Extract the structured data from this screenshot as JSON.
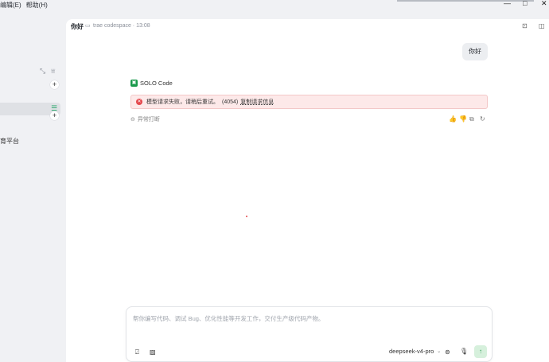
{
  "menubar": {
    "items": [
      "编辑(E)",
      "帮助(H)"
    ]
  },
  "window_controls": {
    "minimize": "—",
    "maximize": "□",
    "close": "✕"
  },
  "sidebar": {
    "collapse_icon": "⤡",
    "filter_icon": "⩸",
    "add_icon": "+",
    "list_icon": "☰",
    "partial_item_label": "育平台"
  },
  "header": {
    "title": "你好",
    "folder_icon": "▭",
    "path": "trae codespace · 13:08",
    "terminal_icon": "⊡",
    "panel_icon": "◫"
  },
  "conversation": {
    "user_message": "你好",
    "agent": {
      "badge": "▣",
      "name": "SOLO Code"
    },
    "error": {
      "icon": "✕",
      "message": "模型请求失败，请稍后重试。",
      "code": "(4054)",
      "link": "复制请求信息"
    },
    "stop": {
      "icon": "⊖",
      "label": "异常打断"
    },
    "actions": {
      "like": "👍",
      "dislike": "👎",
      "copy": "⧉",
      "retry": "↻"
    }
  },
  "composer": {
    "placeholder": "帮你编写代码、调试 Bug、优化性能等开发工作，交付生产级代码产物。",
    "mention_icon": "⍁",
    "image_icon": "▨",
    "model": "deepseek-v4-pro",
    "model_chevron": "⌄",
    "tools_icon": "⊚",
    "mic_icon": "🎙",
    "send_icon": "↑"
  }
}
